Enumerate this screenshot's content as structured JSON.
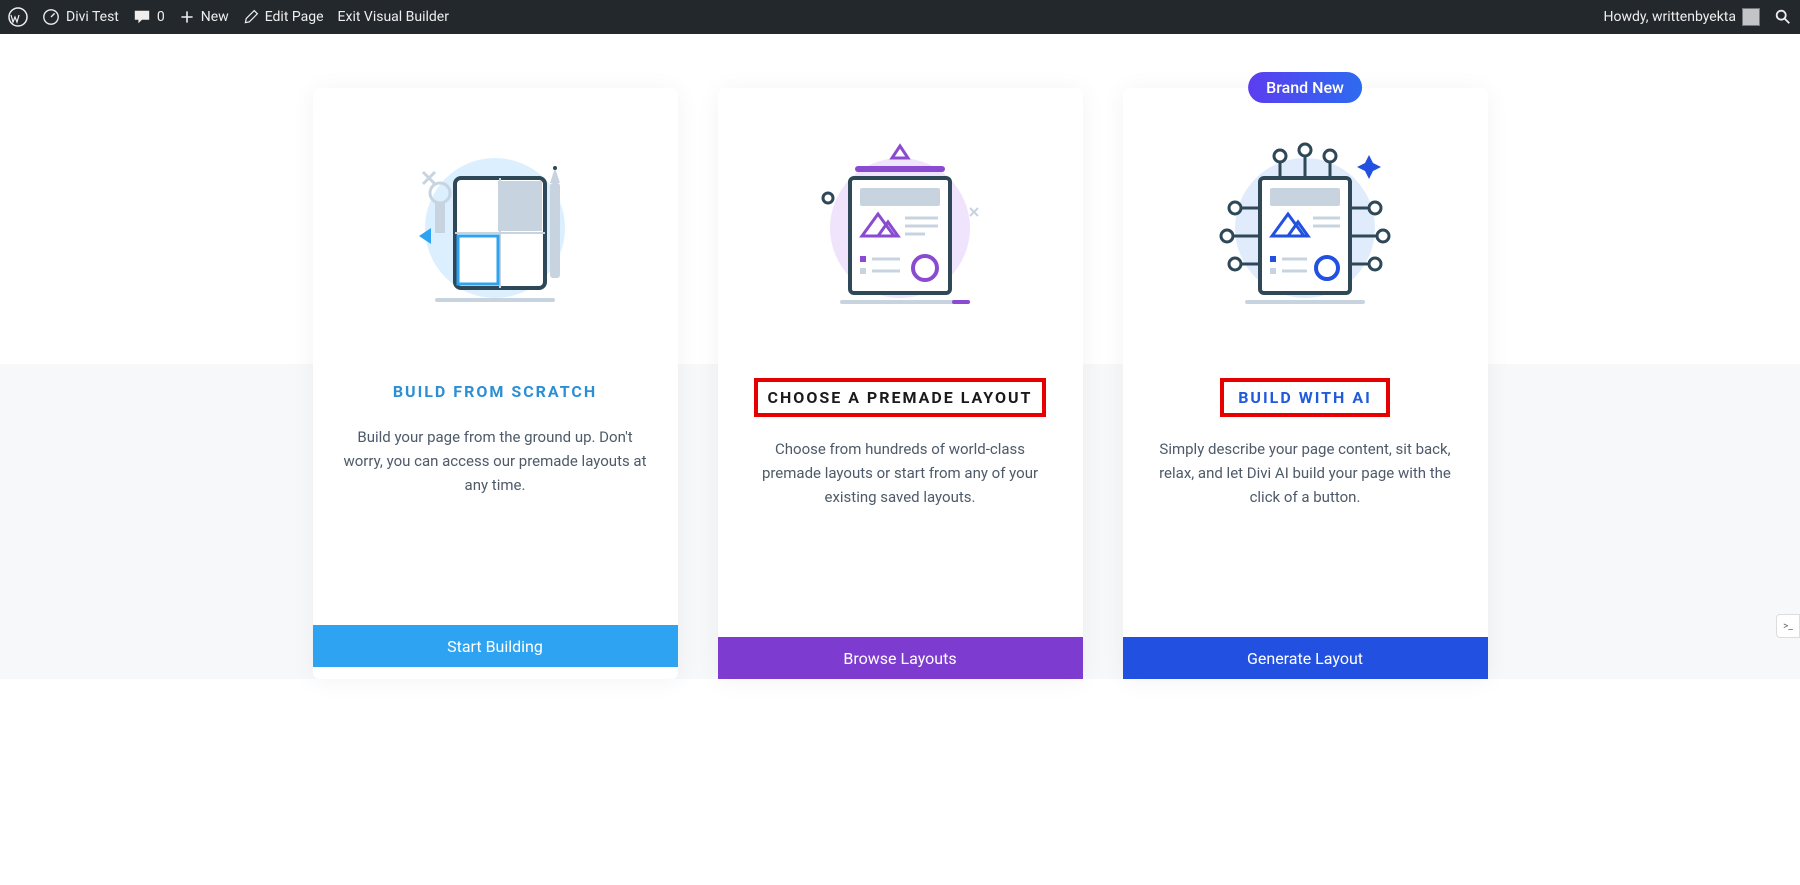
{
  "adminbar": {
    "site_title": "Divi Test",
    "comments_count": "0",
    "new_label": "New",
    "edit_page_label": "Edit Page",
    "exit_vb_label": "Exit Visual Builder",
    "howdy_label": "Howdy, writtenbyekta"
  },
  "cards": {
    "scratch": {
      "title": "BUILD FROM SCRATCH",
      "desc": "Build your page from the ground up. Don't worry, you can access our premade layouts at any time.",
      "button": "Start Building"
    },
    "premade": {
      "title": "CHOOSE A PREMADE LAYOUT",
      "desc": "Choose from hundreds of world-class premade layouts or start from any of your existing saved layouts.",
      "button": "Browse Layouts"
    },
    "ai": {
      "badge": "Brand New",
      "title": "BUILD WITH AI",
      "desc": "Simply describe your page content, sit back, relax, and let Divi AI build your page with the click of a button.",
      "button": "Generate Layout"
    }
  },
  "colors": {
    "scratch_accent": "#2ea3f2",
    "premade_accent": "#7e3bd0",
    "ai_accent": "#2250e0",
    "highlight_border": "#e60000"
  }
}
